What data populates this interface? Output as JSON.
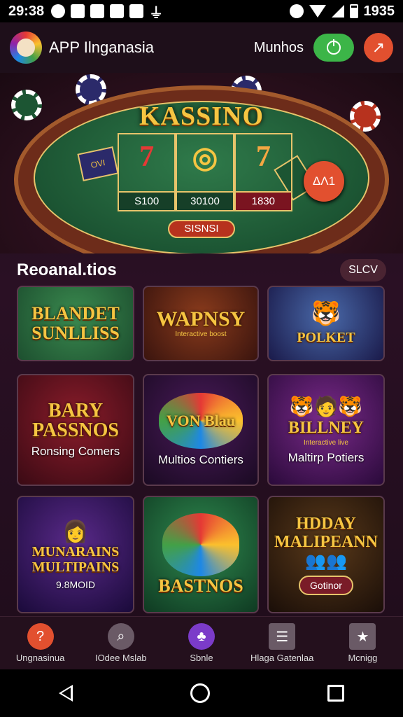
{
  "status_bar": {
    "time": "29:38",
    "battery_text": "1935"
  },
  "header": {
    "app_title": "APP Ilnganasia",
    "menu_label": "Munhos"
  },
  "hero": {
    "title": "KASSINO",
    "reels": [
      {
        "symbol": "7",
        "value": "S100"
      },
      {
        "symbol": "◎",
        "value": "30100"
      },
      {
        "symbol": "7",
        "value": "1830"
      }
    ],
    "spin_label": "SISNSI",
    "badge": "ΔΛ1",
    "side_card": "OVI"
  },
  "section": {
    "title": "Reoanal.tios",
    "see_all": "SLCV"
  },
  "games": [
    {
      "name": "BLANDET SUNLLISS",
      "caption": "",
      "sub": ""
    },
    {
      "name": "WAPNSY",
      "caption": "",
      "sub": "Interactive boost"
    },
    {
      "name": "POLKET",
      "caption": "",
      "sub": ""
    },
    {
      "name": "BARY PASSNOS",
      "caption": "Ronsing Comers",
      "sub": ""
    },
    {
      "name": "VON Blau",
      "caption": "Multios Contiers",
      "sub": ""
    },
    {
      "name": "BILLNEY",
      "caption": "Maltirp Potiers",
      "sub": "Interactive live"
    },
    {
      "name": "MUNARAINS MULTIPAINS",
      "caption": "",
      "sub": "9.8MOID"
    },
    {
      "name": "BASTNOS",
      "caption": "",
      "sub": ""
    },
    {
      "name": "HDDAY MALIPEANN",
      "caption": "",
      "sub": "",
      "pill": "Gotinor"
    }
  ],
  "nav": [
    {
      "label": "Ungnasinua",
      "icon": "home-icon",
      "color": "#e2502f"
    },
    {
      "label": "IOdee Mslab",
      "icon": "search-icon",
      "color": "#6a5a66"
    },
    {
      "label": "Sbnle",
      "icon": "slots-icon",
      "color": "#7b3bc9"
    },
    {
      "label": "Hlaga Gatenlaa",
      "icon": "list-icon",
      "color": "#6a5a66"
    },
    {
      "label": "Mcnigg",
      "icon": "profile-icon",
      "color": "#6a5a66"
    }
  ]
}
